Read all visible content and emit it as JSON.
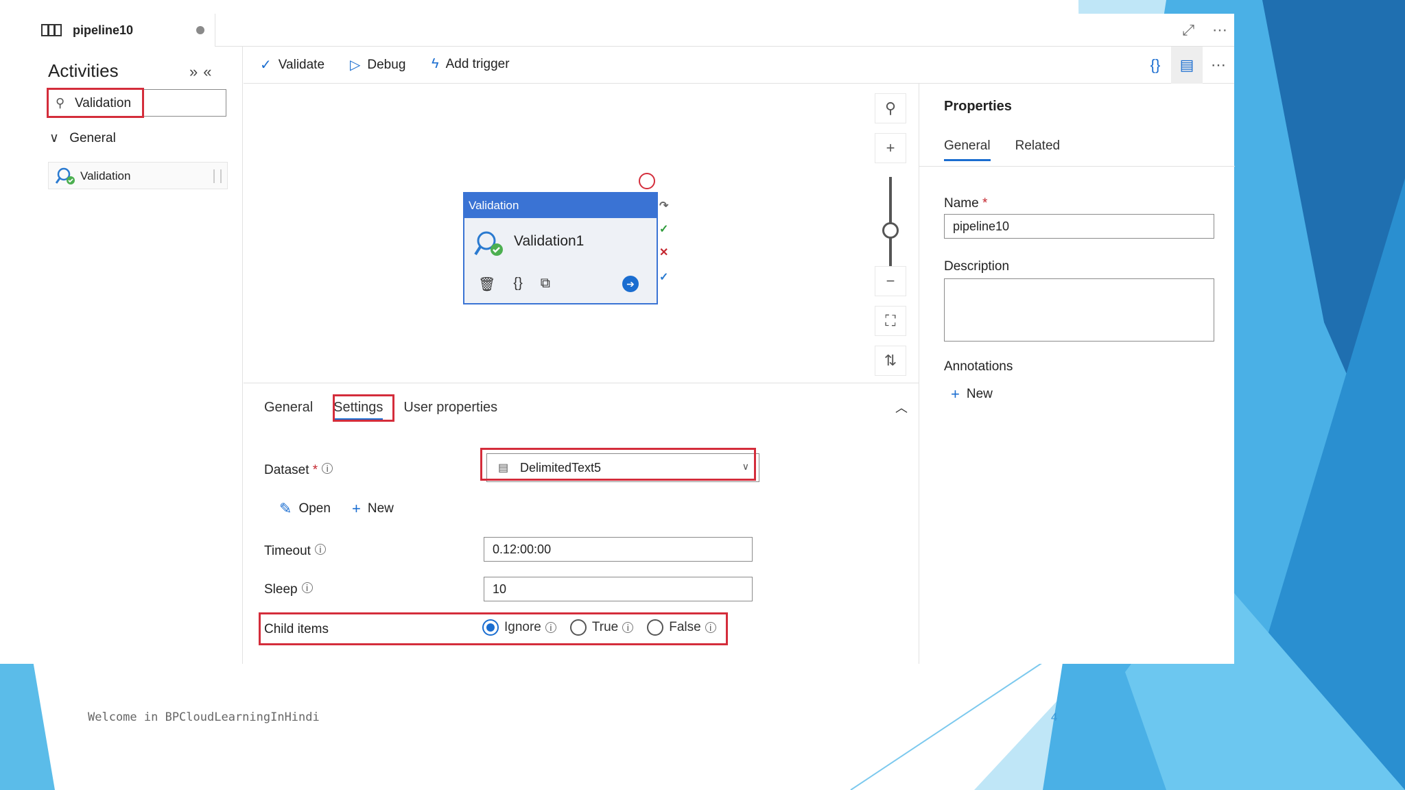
{
  "tab": {
    "title": "pipeline10"
  },
  "activities": {
    "title": "Activities",
    "search_value": "Validation",
    "group_label": "General",
    "item_label": "Validation"
  },
  "toolbar": {
    "validate_label": "Validate",
    "debug_label": "Debug",
    "add_trigger_label": "Add trigger"
  },
  "canvas": {
    "node_header": "Validation",
    "node_name": "Validation1"
  },
  "settings": {
    "tabs": [
      "General",
      "Settings",
      "User properties"
    ],
    "active_tab": "Settings",
    "dataset_label": "Dataset",
    "dataset_value": "DelimitedText5",
    "open_label": "Open",
    "new_label": "New",
    "timeout_label": "Timeout",
    "timeout_value": "0.12:00:00",
    "sleep_label": "Sleep",
    "sleep_value": "10",
    "child_items_label": "Child items",
    "child_items_options": [
      "Ignore",
      "True",
      "False"
    ],
    "child_items_selected": "Ignore"
  },
  "properties": {
    "title": "Properties",
    "tabs": [
      "General",
      "Related"
    ],
    "name_label": "Name",
    "name_value": "pipeline10",
    "description_label": "Description",
    "annotations_label": "Annotations",
    "new_label": "New"
  },
  "slide": {
    "footer": "Welcome in BPCloudLearningInHindi",
    "page_number": "4"
  },
  "colors": {
    "accent_blue": "#1a6dd0",
    "highlight_red": "#d42d3b",
    "node_header": "#3a73d4"
  }
}
